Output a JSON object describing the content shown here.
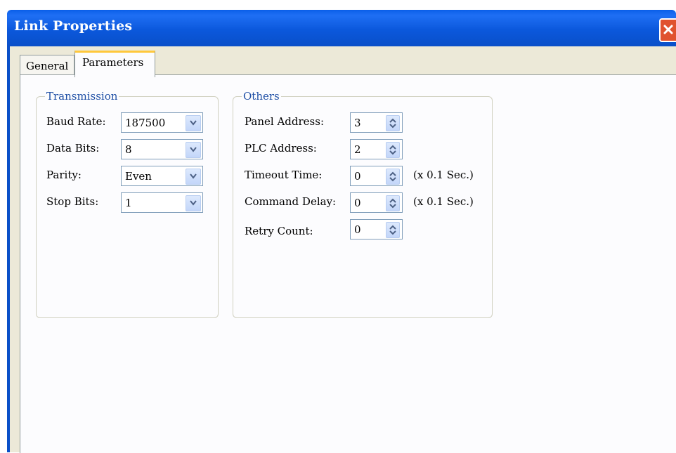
{
  "window": {
    "title": "Link Properties"
  },
  "tabs": [
    {
      "label": "General"
    },
    {
      "label": "Parameters"
    }
  ],
  "transmission": {
    "legend": "Transmission",
    "fields": [
      {
        "label": "Baud Rate:",
        "value": "187500"
      },
      {
        "label": "Data Bits:",
        "value": "8"
      },
      {
        "label": "Parity:",
        "value": "Even"
      },
      {
        "label": "Stop Bits:",
        "value": "1"
      }
    ]
  },
  "others": {
    "legend": "Others",
    "fields": [
      {
        "label": "Panel Address:",
        "value": "3",
        "unit": ""
      },
      {
        "label": "PLC Address:",
        "value": "2",
        "unit": ""
      },
      {
        "label": "Timeout Time:",
        "value": "0",
        "unit": "(x 0.1 Sec.)"
      },
      {
        "label": "Command Delay:",
        "value": "0",
        "unit": "(x 0.1 Sec.)"
      },
      {
        "label": "Retry Count:",
        "value": "0",
        "unit": ""
      }
    ]
  },
  "icons": {
    "close": "close-icon",
    "dropdown": "chevron-down-icon",
    "spinner": "spin-updown-icon"
  },
  "colors": {
    "titlebar": "#0a5ee8",
    "close": "#e0522f",
    "legend": "#1f4fa5",
    "active_tab_accent": "#ffc83c"
  }
}
